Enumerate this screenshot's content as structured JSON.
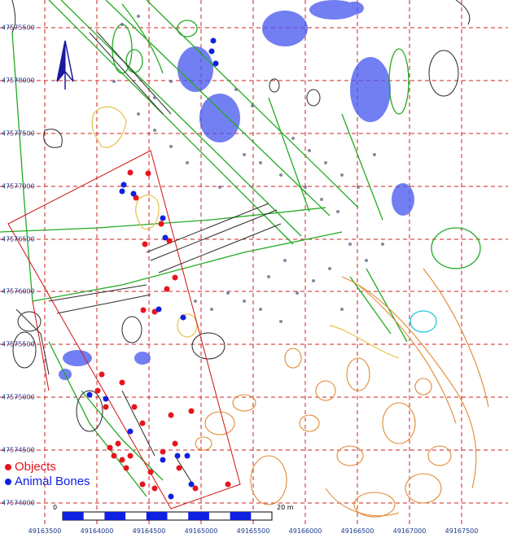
{
  "grid": {
    "y_labels": [
      "47575500",
      "47578000",
      "47577500",
      "47577000",
      "47576500",
      "47576000",
      "47575500",
      "47575000",
      "47574500",
      "47574000"
    ],
    "x_labels": [
      "49163500",
      "49164000",
      "49164500",
      "49165000",
      "49165500",
      "49166000",
      "49166500",
      "49167000",
      "49167500"
    ]
  },
  "legend": {
    "objects_label": "Objects",
    "bones_label": "Animal Bones",
    "objects_color": "#e8141e",
    "bones_color": "#1020e0"
  },
  "scale": {
    "start_label": "0",
    "end_label": "20 m"
  },
  "north_arrow": {
    "label": "N"
  },
  "colors": {
    "grid": "#cc2222",
    "features": "#2a2a2a",
    "green": "#22aa22",
    "orange": "#e08a30",
    "blue_scatter": "#4455ee",
    "frame": "#d01010"
  }
}
